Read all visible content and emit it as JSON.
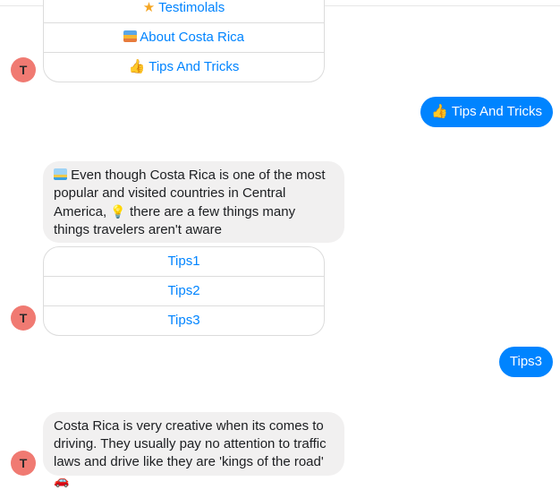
{
  "avatar_initial": "T",
  "menu1": {
    "items": [
      {
        "icon": "star-icon",
        "label": "Testimolals"
      },
      {
        "icon": "sunrise-icon",
        "label": "About Costa Rica"
      },
      {
        "icon": "thumbs-up-icon",
        "label": "Tips And Tricks"
      }
    ]
  },
  "user_msg1": {
    "icon": "thumbs-up-icon",
    "text": "Tips And Tricks"
  },
  "bot_msg1": {
    "text_a": "Even though Costa Rica is one of the most popular and visited countries in Central America,",
    "text_b": "there are a few things many things travelers aren't aware"
  },
  "menu2": {
    "items": [
      {
        "label": "Tips1"
      },
      {
        "label": "Tips2"
      },
      {
        "label": "Tips3"
      }
    ]
  },
  "user_msg2": {
    "text": "Tips3"
  },
  "bot_msg2": {
    "text": "Costa Rica is very creative when its comes to driving. They usually pay no attention to traffic laws and drive like they are 'kings of the road'"
  }
}
